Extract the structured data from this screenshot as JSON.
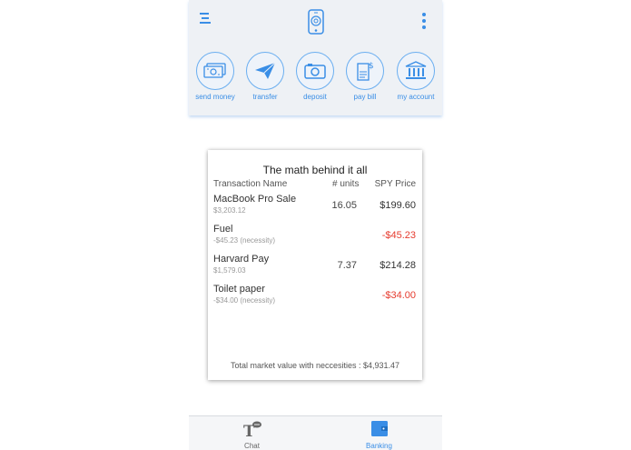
{
  "header": {
    "menu_icon": "menu-icon",
    "logo_icon": "phone-logo-icon",
    "more_icon": "more-vertical-icon"
  },
  "actions": [
    {
      "label": "send money",
      "icon": "money-icon"
    },
    {
      "label": "transfer",
      "icon": "paper-plane-icon"
    },
    {
      "label": "deposit",
      "icon": "camera-icon"
    },
    {
      "label": "pay bill",
      "icon": "bill-icon"
    },
    {
      "label": "my account",
      "icon": "bank-icon"
    }
  ],
  "card": {
    "title": "The math behind it all",
    "columns": {
      "name": "Transaction Name",
      "units": "# units",
      "price": "SPY Price"
    },
    "rows": [
      {
        "name": "MacBook Pro Sale",
        "sub": "$3,203.12",
        "units": "16.05",
        "price": "$199.60",
        "negative": false
      },
      {
        "name": "Fuel",
        "sub": "-$45.23 (necessity)",
        "units": "",
        "price": "-$45.23",
        "negative": true
      },
      {
        "name": "Harvard Pay",
        "sub": "$1,579.03",
        "units": "7.37",
        "price": "$214.28",
        "negative": false
      },
      {
        "name": "Toilet paper",
        "sub": "-$34.00 (necessity)",
        "units": "",
        "price": "-$34.00",
        "negative": true
      }
    ],
    "footer": "Total market value with neccesities : $4,931.47"
  },
  "tabs": [
    {
      "label": "Chat",
      "icon": "chat-text-icon",
      "active": false
    },
    {
      "label": "Banking",
      "icon": "wallet-icon",
      "active": true
    }
  ],
  "colors": {
    "accent": "#3a8ee6",
    "negative": "#e63c2f",
    "inactive": "#666666"
  }
}
